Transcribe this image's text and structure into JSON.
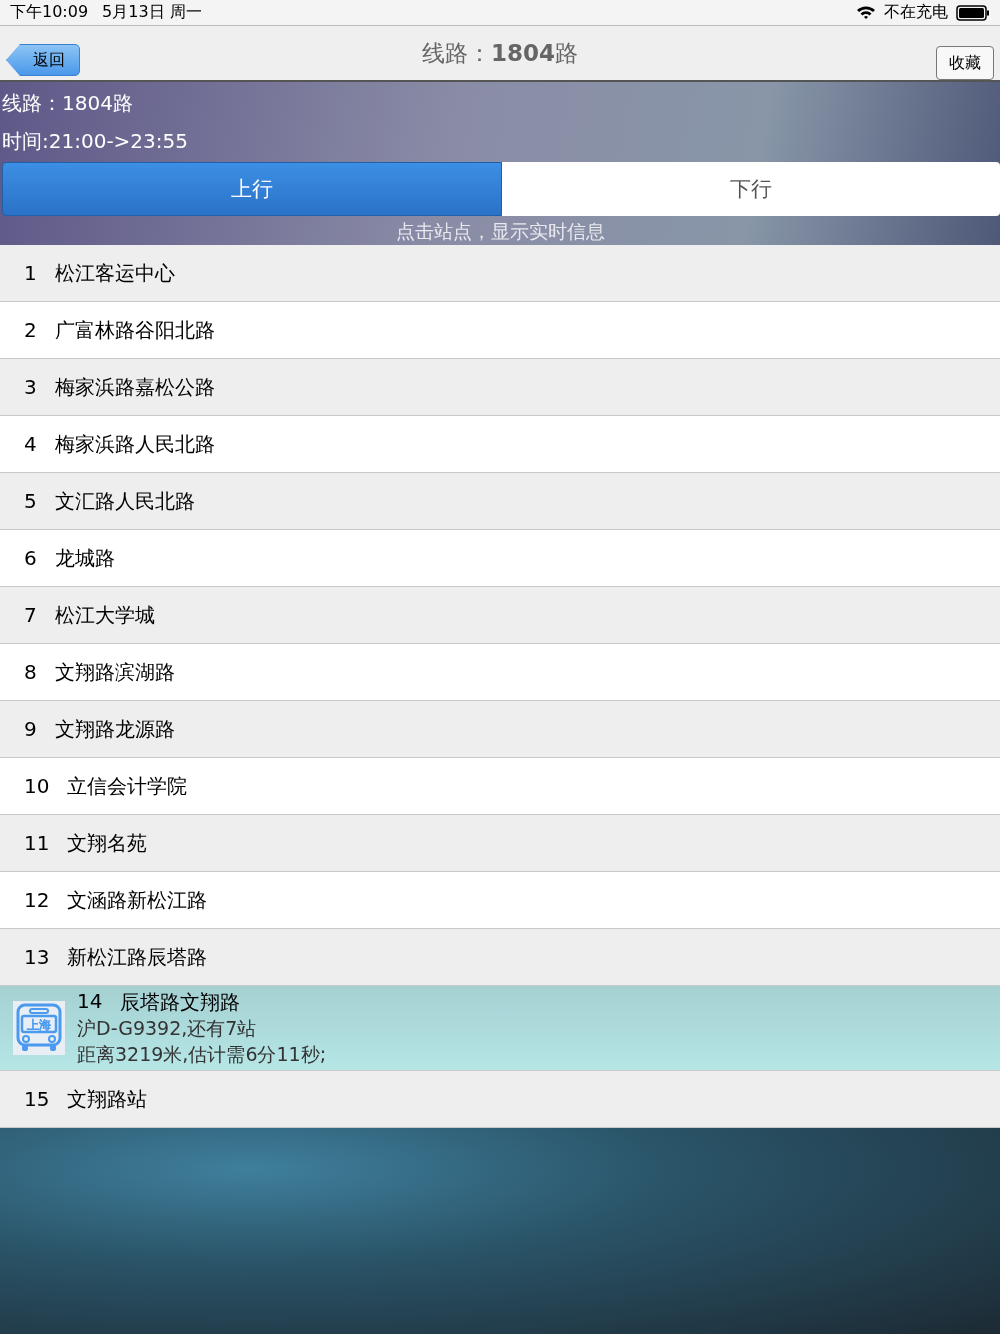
{
  "status_bar": {
    "time": "下午10:09",
    "date": "5月13日 周一",
    "charging": "不在充电"
  },
  "nav": {
    "back": "返回",
    "title": "线路：**1804**路",
    "favorite": "收藏"
  },
  "header": {
    "line": "线路：1804路",
    "time": "时间:21:00->23:55",
    "hint": "点击站点，显示实时信息"
  },
  "tabs": [
    {
      "label": "上行",
      "selected": true
    },
    {
      "label": "下行",
      "selected": false
    }
  ],
  "stops": [
    {
      "kind": "stop",
      "number": "1",
      "name": "松江客运中心"
    },
    {
      "kind": "stop",
      "number": "2",
      "name": "广富林路谷阳北路"
    },
    {
      "kind": "stop",
      "number": "3",
      "name": "梅家浜路嘉松公路"
    },
    {
      "kind": "stop",
      "number": "4",
      "name": "梅家浜路人民北路"
    },
    {
      "kind": "stop",
      "number": "5",
      "name": "文汇路人民北路"
    },
    {
      "kind": "stop",
      "number": "6",
      "name": "龙城路"
    },
    {
      "kind": "stop",
      "number": "7",
      "name": "松江大学城"
    },
    {
      "kind": "stop",
      "number": "8",
      "name": "文翔路滨湖路"
    },
    {
      "kind": "stop",
      "number": "9",
      "name": "文翔路龙源路"
    },
    {
      "kind": "stop",
      "number": "10",
      "name": "立信会计学院"
    },
    {
      "kind": "stop",
      "number": "11",
      "name": "文翔名苑"
    },
    {
      "kind": "stop",
      "number": "12",
      "name": "文涵路新松江路"
    },
    {
      "kind": "stop",
      "number": "13",
      "name": "新松江路辰塔路"
    },
    {
      "kind": "bus",
      "number": "14",
      "name": "辰塔路文翔路",
      "icon_label": "上海",
      "plate": "沪D-G9392,还有7站",
      "eta": "距离3219米,估计需6分11秒;"
    },
    {
      "kind": "stop",
      "number": "15",
      "name": "文翔路站"
    }
  ]
}
